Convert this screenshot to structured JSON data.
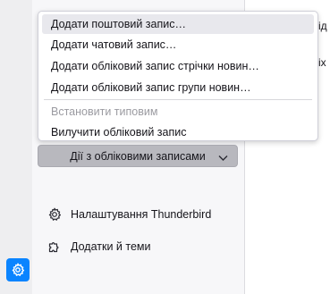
{
  "menu": {
    "items": [
      {
        "label": "Додати поштовий запис…",
        "state": "hover"
      },
      {
        "label": "Додати чатовий запис…",
        "state": "normal"
      },
      {
        "label": "Додати обліковий запис стрічки новин…",
        "state": "normal"
      },
      {
        "label": "Додати обліковий запис групи новин…",
        "state": "normal"
      },
      {
        "label": "Встановити типовим",
        "state": "disabled"
      },
      {
        "label": "Вилучити обліковий запис",
        "state": "normal"
      }
    ]
  },
  "accounts_button": {
    "label": "Дії з обліковими записами",
    "icon": "chevron-down-icon"
  },
  "sidebar": {
    "links": [
      {
        "label": "Налаштування Thunderbird",
        "icon": "gear-icon"
      },
      {
        "label": "Додатки й теми",
        "icon": "puzzle-icon"
      }
    ]
  },
  "right_pane": {
    "fragments": [
      "ід",
      "іх"
    ]
  },
  "colors": {
    "accent": "#0a84ff",
    "button_bg": "#b8b8be",
    "menu_hover": "#e8e8ed",
    "disabled_text": "#9b9ba1"
  }
}
